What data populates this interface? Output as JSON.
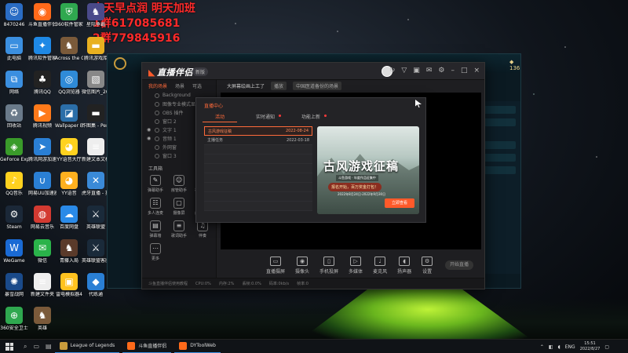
{
  "overlay": {
    "line1": "今天早点润 明天加班",
    "line2": "1群617085681",
    "line3": "2群779845916"
  },
  "desktop_icons": [
    {
      "label": "8470246",
      "icon": "user-icon",
      "color": "#2a6cc4"
    },
    {
      "label": "斗鱼直播伴侣",
      "icon": "douyu-icon",
      "color": "#ff6a1a"
    },
    {
      "label": "360软件管家",
      "icon": "shield-icon",
      "color": "#2fa84f"
    },
    {
      "label": "星际争霸",
      "icon": "game-icon",
      "color": "#4a4a8a"
    },
    {
      "label": "此电脑",
      "icon": "computer-icon",
      "color": "#3b8fe0"
    },
    {
      "label": "腾讯软件管家",
      "icon": "tencent-icon",
      "color": "#1e88e5"
    },
    {
      "label": "Across the Obelisk",
      "icon": "game-icon",
      "color": "#7a5a3a"
    },
    {
      "label": "腾讯游戏库",
      "icon": "folder-icon",
      "color": "#e8b020"
    },
    {
      "label": "网络",
      "icon": "network-icon",
      "color": "#3b8fe0"
    },
    {
      "label": "腾讯QQ",
      "icon": "qq-icon",
      "color": "#222"
    },
    {
      "label": "QQ浏览器",
      "icon": "browser-icon",
      "color": "#2f8bd8"
    },
    {
      "label": "微信图片_2022081...",
      "icon": "image-icon",
      "color": "#888"
    },
    {
      "label": "回收站",
      "icon": "trash-icon",
      "color": "#6a7a8a"
    },
    {
      "label": "腾讯视频",
      "icon": "video-icon",
      "color": "#ff7a1a"
    },
    {
      "label": "Wallpaper Engine...",
      "icon": "wallpaper-icon",
      "color": "#2b6ea8"
    },
    {
      "label": "炸图集 - PerfOrMa...",
      "icon": "folder-icon",
      "color": "#222"
    },
    {
      "label": "GeForce Experience",
      "icon": "nvidia-icon",
      "color": "#3a9b2a"
    },
    {
      "label": "腾讯网游加速器",
      "icon": "speed-icon",
      "color": "#2a7fd4"
    },
    {
      "label": "YY语音大厅",
      "icon": "yy-icon",
      "color": "#ffd21f"
    },
    {
      "label": "新建文本文档",
      "icon": "document-icon",
      "color": "#eee"
    },
    {
      "label": "QQ音乐",
      "icon": "music-icon",
      "color": "#ffd21f"
    },
    {
      "label": "网易UU加速器",
      "icon": "uu-icon",
      "color": "#2a7fd4"
    },
    {
      "label": "YY语音",
      "icon": "yy-icon",
      "color": "#ffb01f"
    },
    {
      "label": "虎牙直播 - 提示",
      "icon": "huya-icon",
      "color": "#3a8ad8"
    },
    {
      "label": "Steam",
      "icon": "steam-icon",
      "color": "#1b2838"
    },
    {
      "label": "网易云音乐",
      "icon": "netease-music-icon",
      "color": "#d33a31"
    },
    {
      "label": "百度网盘",
      "icon": "cloud-icon",
      "color": "#2a8ae8"
    },
    {
      "label": "英雄联盟",
      "icon": "lol-icon",
      "color": "#1a2a3a"
    },
    {
      "label": "WeGame",
      "icon": "wegame-icon",
      "color": "#1a6ad4"
    },
    {
      "label": "微信",
      "icon": "wechat-icon",
      "color": "#2ab34a"
    },
    {
      "label": "青藤入局",
      "icon": "game-icon",
      "color": "#5a3a2a"
    },
    {
      "label": "英雄联盟客服",
      "icon": "lol-icon",
      "color": "#1a2a3a"
    },
    {
      "label": "暴雪战网",
      "icon": "battlenet-icon",
      "color": "#1a4a8a"
    },
    {
      "label": "新建文件夹",
      "icon": "document-icon",
      "color": "#eee"
    },
    {
      "label": "雷电模拟器4",
      "icon": "emulator-icon",
      "color": "#ffc21f"
    },
    {
      "label": "代练通",
      "icon": "app-icon",
      "color": "#2a7fd4"
    },
    {
      "label": "360安全卫士",
      "icon": "360-icon",
      "color": "#2fa84f"
    },
    {
      "label": "英雄",
      "icon": "game-icon",
      "color": "#7a5a3a"
    }
  ],
  "lol_client": {
    "title": "League of Legends",
    "currency": "136"
  },
  "app": {
    "brand": "直播伴侣",
    "version": "新版",
    "sidebar_tabs": [
      "我的场景",
      "场景",
      "可选"
    ],
    "layers": [
      "Background",
      "图像专业模式显示窗口",
      "OBS 插件",
      "窗口 2",
      "文字 1",
      "音频 1",
      "外网窗",
      "窗口 3"
    ],
    "tools_title": "工具箱",
    "tools": [
      "弹幕助手",
      "房管助手",
      "视频连麦",
      "多人连麦",
      "摄像屏",
      "虚拟形象",
      "弹幕墙",
      "歌词助手",
      "伴奏",
      "更多"
    ],
    "scene_bar_text": "大屏幕绘画上工了",
    "scene_chip1": "播放",
    "scene_chip2": "中国医道备份的场景",
    "controls": [
      "直播摄屏",
      "摄像头",
      "手机投屏",
      "多媒体",
      "麦克风",
      "扬声器",
      "设置"
    ],
    "start_live": "开始直播",
    "statusbar": [
      "斗鱼直播伴侣使用教程",
      "CPU:0%",
      "内存:2%",
      "丢帧:0.0%",
      "码率:0kb/s",
      "帧率:0"
    ]
  },
  "dialog": {
    "title": "直播中心",
    "tabs": [
      {
        "label": "活动",
        "active": true,
        "dot": false
      },
      {
        "label": "实时通知",
        "active": false,
        "dot": true
      },
      {
        "label": "功能上新",
        "active": false,
        "dot": true
      }
    ],
    "items": [
      {
        "name": "古风游戏征稿",
        "date": "2022-08-24",
        "selected": true
      },
      {
        "name": "主播任务",
        "date": "2022-03-18",
        "selected": false
      }
    ],
    "banner": {
      "heading": "古风游戏征稿",
      "sub": "斗鱼游戏 · 年度作品征集中",
      "prize": "报名开始，百万奖金打包！",
      "date": "2022年8月24日-2022年9月30日",
      "cta": "立即查看"
    }
  },
  "taskbar": {
    "items": [
      {
        "label": "League of Legends",
        "color": "#c89b3c"
      },
      {
        "label": "斗鱼直播伴侣",
        "color": "#ff6a1a"
      },
      {
        "label": "DYToolWeb",
        "color": "#ff6a1a"
      }
    ],
    "lang": "ENG",
    "time": "15:51",
    "date": "2022/8/27"
  }
}
